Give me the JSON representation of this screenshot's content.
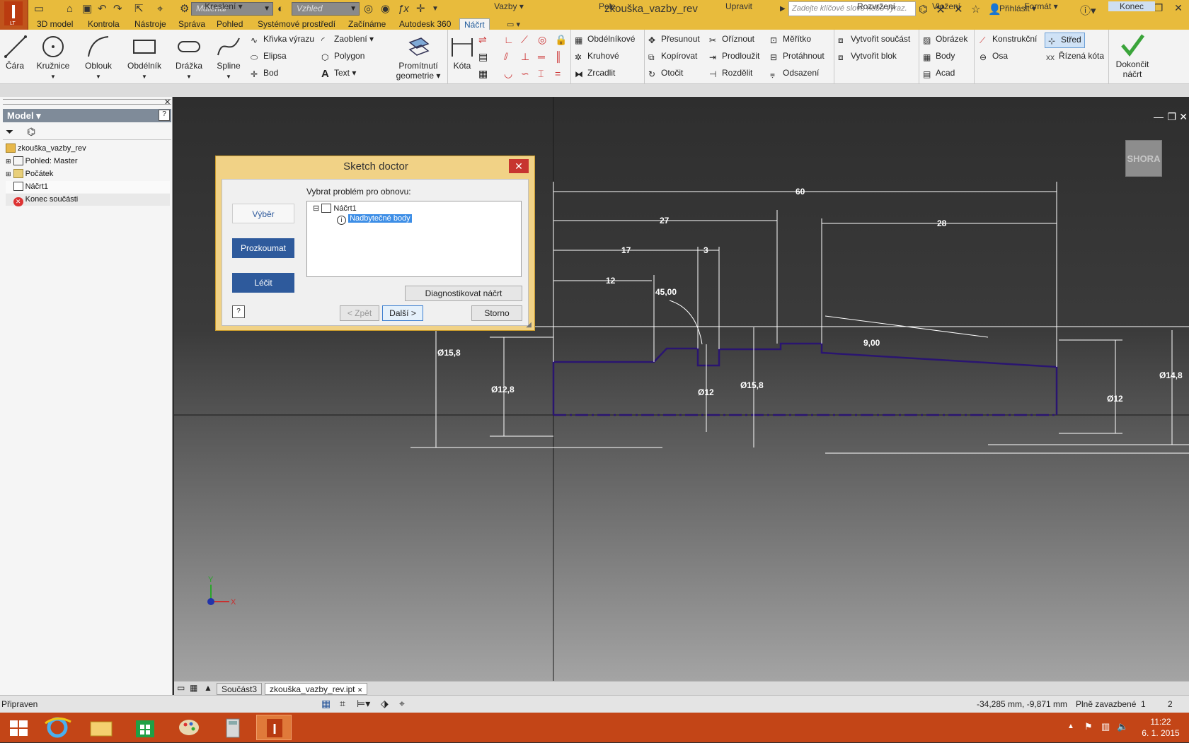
{
  "titlebar": {
    "material_placeholder": "Materiál",
    "appearance_placeholder": "Vzhled",
    "doc_title": "zkouška_vazby_rev",
    "help_search_placeholder": "Zadejte klíčové slovo nebo výraz.",
    "login_label": "Přihlásit",
    "app_suffix": "LT"
  },
  "menu": {
    "tabs": [
      "3D model",
      "Kontrola",
      "Nástroje",
      "Správa",
      "Pohled",
      "Systémové prostředí",
      "Začínáme",
      "Autodesk 360",
      "Náčrt"
    ],
    "active": "Náčrt"
  },
  "ribbon": {
    "draw": {
      "line": "Čára",
      "circle": "Kružnice",
      "arc": "Oblouk",
      "rectangle": "Obdélník",
      "slot": "Drážka",
      "spline": "Spline",
      "equation_curve": "Křivka výrazu",
      "ellipse": "Elipsa",
      "point": "Bod",
      "fillet": "Zaoblení",
      "polygon": "Polygon",
      "text": "Text",
      "project": "Promítnutí",
      "project2": "geometrie"
    },
    "constrain": {
      "dimension": "Kóta"
    },
    "pattern": {
      "rectangular": "Obdélníkové",
      "circular": "Kruhové",
      "mirror": "Zrcadlit"
    },
    "modify": {
      "move": "Přesunout",
      "copy": "Kopírovat",
      "rotate": "Otočit",
      "trim": "Oříznout",
      "extend": "Prodloužit",
      "split": "Rozdělit",
      "scale": "Měřítko",
      "stretch": "Protáhnout",
      "offset": "Odsazení"
    },
    "layout": {
      "make_part": "Vytvořit součást",
      "make_block": "Vytvořit blok"
    },
    "insert": {
      "image": "Obrázek",
      "points": "Body",
      "acad": "Acad"
    },
    "format": {
      "construction": "Konstrukční",
      "axis": "Osa",
      "center": "Střed",
      "driven": "Řízená kóta"
    },
    "finish": {
      "label1": "Dokončit",
      "label2": "náčrt"
    },
    "panels": [
      "Kreslení",
      "Vazby",
      "Pole",
      "Upravit",
      "Rozvržení",
      "Vložení",
      "Formát",
      "Konec"
    ]
  },
  "browser": {
    "title": "Model",
    "items": [
      "zkouška_vazby_rev",
      "Pohled: Master",
      "Počátek",
      "Náčrt1",
      "Konec součásti"
    ]
  },
  "viewcube": {
    "label": "SHORA"
  },
  "dialog": {
    "title": "Sketch doctor",
    "prompt": "Vybrat problém pro obnovu:",
    "side_buttons": [
      "Výběr",
      "Prozkoumat",
      "Léčit"
    ],
    "tree_root": "Náčrt1",
    "tree_child": "Nadbytečné body",
    "diagnose_button": "Diagnostikovat náčrt",
    "back_button": "< Zpět",
    "next_button": "Další >",
    "cancel_button": "Storno"
  },
  "dimensions": [
    "60",
    "27",
    "17",
    "3",
    "12",
    "45,00",
    "28",
    "9,00",
    "Ø15,8",
    "Ø12,8",
    "Ø12",
    "Ø15,8",
    "Ø12",
    "Ø14,8"
  ],
  "doc_tabs": [
    "Součást3",
    "zkouška_vazby_rev.ipt"
  ],
  "status": {
    "left": "Připraven",
    "coords": "-34,285 mm, -9,871 mm",
    "constraint_state": "Plně zavazbené",
    "count1": "1",
    "count2": "2"
  },
  "taskbar": {
    "time": "11:22",
    "date": "6. 1. 2015"
  },
  "colors": {
    "titlebar": "#e8bb3c",
    "sketch_line": "#2a1570",
    "dialog_primary": "#2e5a9c",
    "taskbar": "#c34517"
  }
}
